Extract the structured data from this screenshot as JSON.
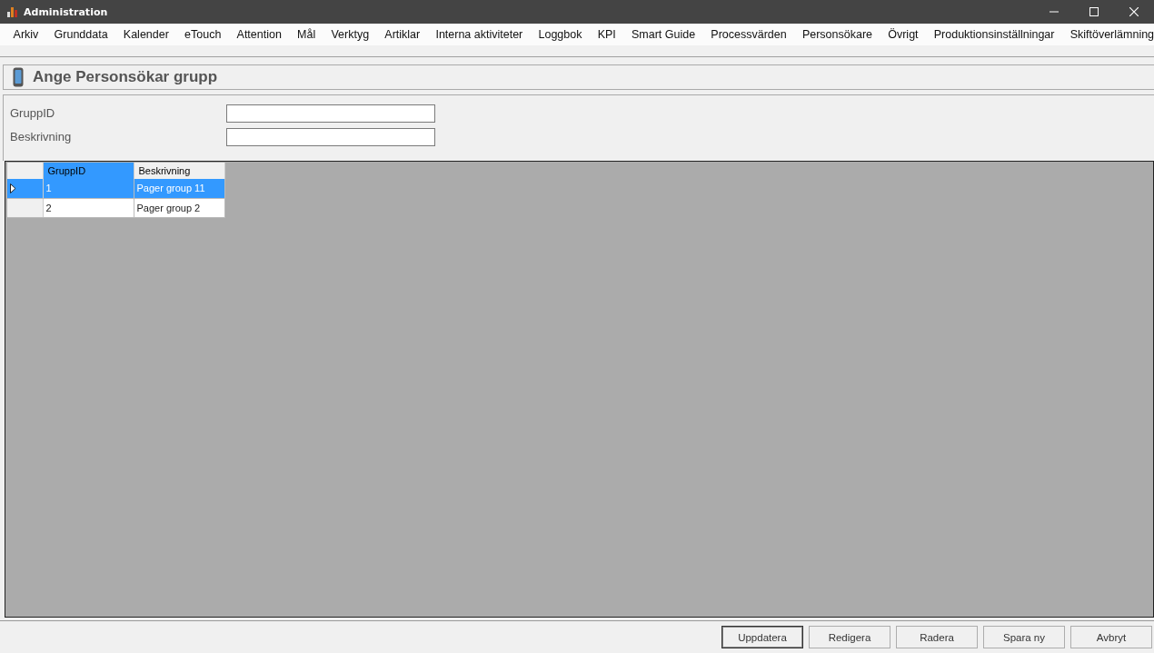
{
  "window": {
    "title": "Administration"
  },
  "menu": [
    "Arkiv",
    "Grunddata",
    "Kalender",
    "eTouch",
    "Attention",
    "Mål",
    "Verktyg",
    "Artiklar",
    "Interna aktiviteter",
    "Loggbok",
    "KPI",
    "Smart Guide",
    "Processvärden",
    "Personsökare",
    "Övrigt",
    "Produktionsinställningar",
    "Skiftöverlämning"
  ],
  "header": {
    "title": "Ange Personsökar grupp"
  },
  "form": [
    {
      "label": "GruppID"
    },
    {
      "label": "Beskrivning"
    }
  ],
  "table": {
    "columns": [
      {
        "label": "GruppID",
        "selected": true
      },
      {
        "label": "Beskrivning",
        "selected": false
      }
    ],
    "rows": [
      {
        "cells": [
          "1",
          "Pager group 11"
        ],
        "selected": true
      },
      {
        "cells": [
          "2",
          "Pager group 2"
        ],
        "selected": false
      }
    ]
  },
  "buttons": [
    {
      "label": "Uppdatera",
      "default": true
    },
    {
      "label": "Redigera",
      "default": false
    },
    {
      "label": "Radera",
      "default": false
    },
    {
      "label": "Spara ny",
      "default": false
    },
    {
      "label": "Avbryt",
      "default": false
    }
  ]
}
